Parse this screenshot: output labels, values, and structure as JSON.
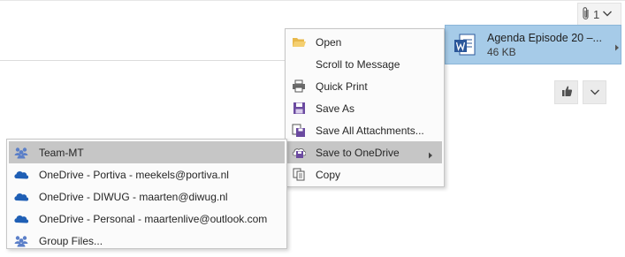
{
  "attachment_indicator": {
    "count": "1",
    "icons": {
      "paperclip": "paperclip-icon",
      "chevron": "chevron-down-icon"
    }
  },
  "attachment": {
    "name": "Agenda Episode 20 –...",
    "size": "46 KB",
    "icon": "word-document-icon",
    "accent": "#a6cbe8"
  },
  "reactions": {
    "like_icon": "thumbs-up-icon",
    "more_icon": "chevron-down-icon"
  },
  "context_menu": {
    "items": [
      {
        "label": "Open",
        "icon": "folder-open-icon"
      },
      {
        "label": "Scroll to Message",
        "icon": ""
      },
      {
        "label": "Quick Print",
        "icon": "printer-icon"
      },
      {
        "label": "Save As",
        "icon": "save-icon"
      },
      {
        "label": "Save All Attachments...",
        "icon": "save-all-icon"
      },
      {
        "label": "Save to OneDrive",
        "icon": "save-cloud-icon",
        "highlighted": true,
        "has_submenu": true
      },
      {
        "label": "Copy",
        "icon": "copy-icon"
      }
    ]
  },
  "onedrive_menu": {
    "items": [
      {
        "label": "Team-MT",
        "icon": "group-icon",
        "highlighted": true
      },
      {
        "label": "OneDrive - Portiva - meekels@portiva.nl",
        "icon": "onedrive-cloud-icon"
      },
      {
        "label": "OneDrive - DIWUG - maarten@diwug.nl",
        "icon": "onedrive-cloud-icon"
      },
      {
        "label": "OneDrive - Personal - maartenlive@outlook.com",
        "icon": "onedrive-cloud-icon"
      },
      {
        "label": "Group Files...",
        "icon": "group-icon"
      }
    ]
  },
  "colors": {
    "highlight": "#c6c6c6",
    "onedrive_blue": "#1f5fb5",
    "group_blue": "#5b7fc8",
    "save_purple": "#6b4aa0"
  }
}
